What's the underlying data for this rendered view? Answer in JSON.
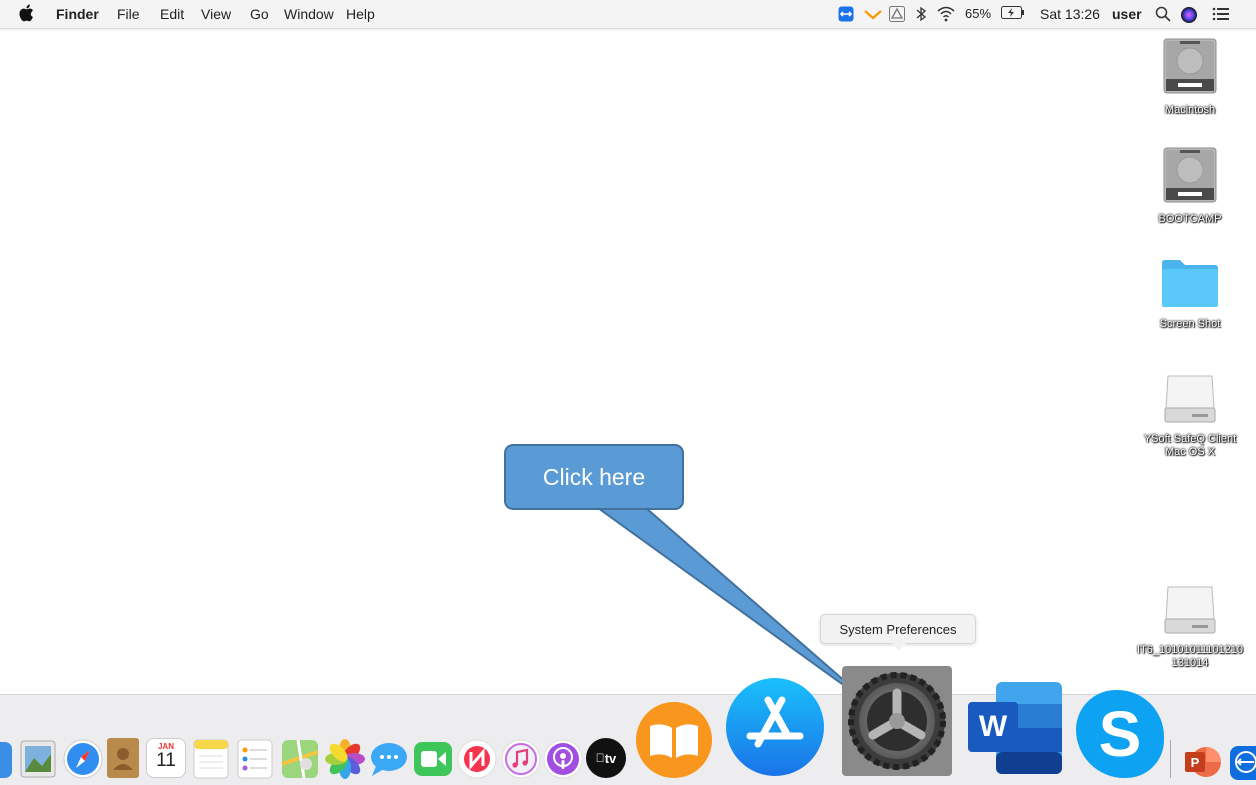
{
  "menubar": {
    "app_name": "Finder",
    "menus": [
      "File",
      "Edit",
      "View",
      "Go",
      "Window",
      "Help"
    ],
    "battery": "65%",
    "clock": "Sat 13:26",
    "user": "user",
    "icons": [
      "teamviewer-icon",
      "vpn-icon",
      "google-drive-icon",
      "bluetooth-icon",
      "wifi-icon",
      "battery-icon",
      "search-icon",
      "siri-icon",
      "control-center-icon"
    ]
  },
  "desktop": {
    "items": [
      {
        "label": "Macintosh",
        "icon": "hard-drive-icon"
      },
      {
        "label": "BOOTCAMP",
        "icon": "hard-drive-icon"
      },
      {
        "label": "Screen Shot",
        "icon": "folder-icon"
      },
      {
        "label": "YSoft SafeQ Client Mac OS X",
        "icon": "disk-image-icon"
      },
      {
        "label": "IT6_10101011101210131014",
        "icon": "disk-image-icon"
      }
    ]
  },
  "callout": {
    "text": "Click here"
  },
  "tooltip": {
    "text": "System Preferences"
  },
  "dock": {
    "apps": [
      "Finder",
      "Preview",
      "Safari",
      "Contacts",
      "Calendar",
      "Notes",
      "Reminders",
      "Maps",
      "Photos",
      "Messages",
      "FaceTime",
      "News",
      "iTunes",
      "Podcasts",
      "TV",
      "Books",
      "App Store",
      "System Preferences",
      "Microsoft Word",
      "Skype",
      "Microsoft PowerPoint",
      "TeamViewer"
    ],
    "calendar": {
      "month": "JAN",
      "day": "11"
    },
    "tv_label": "tv",
    "word_letter": "W",
    "skype_letter": "S",
    "ppt_letter": "P"
  },
  "colors": {
    "callout_fill": "#5b9bd5",
    "callout_border": "#41719c",
    "folder": "#5ac8fa"
  }
}
